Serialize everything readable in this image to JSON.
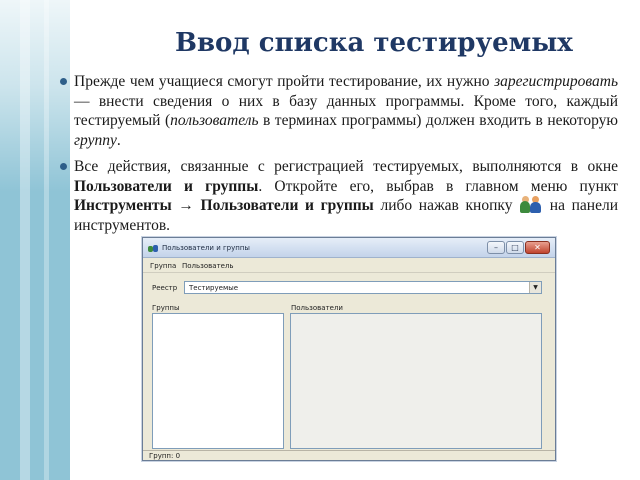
{
  "slide": {
    "title": "Ввод списка тестируемых"
  },
  "bullets": [
    {
      "s1": "Прежде чем учащиеся смогут пройти тестирование, их нужно ",
      "i1": "зарегистрировать",
      "s2": " — внести сведения о них в базу данных программы. Кроме того, каждый тестируемый (",
      "i2": "пользователь",
      "s3": " в терминах программы) должен входить в некоторую ",
      "i3": "группу",
      "s4": "."
    },
    {
      "s1": "Все действия, связанные с регистрацией тестируемых, выполняются в окне ",
      "b1": "Пользователи и группы",
      "s2": ". Откройте его, выбрав в главном меню пункт ",
      "b2": "Инструменты → Пользователи и группы",
      "s3": " либо нажав кнопку ",
      "icon": "users-group-icon",
      "s4": " на панели инструментов."
    }
  ],
  "window": {
    "title": "Пользователи и группы",
    "menu": [
      "Группа",
      "Пользователь"
    ],
    "registry_label": "Реестр",
    "registry_value": "Тестируемые",
    "groups_label": "Группы",
    "users_label": "Пользователи",
    "status": "Групп: 0",
    "buttons": {
      "minimize": "–",
      "maximize": "□",
      "close": "✕"
    },
    "dropdown_arrow": "▼"
  },
  "colors": {
    "title": "#1f3864",
    "side_band": "#8fc4d6",
    "bullet": "#2e5f8a"
  }
}
